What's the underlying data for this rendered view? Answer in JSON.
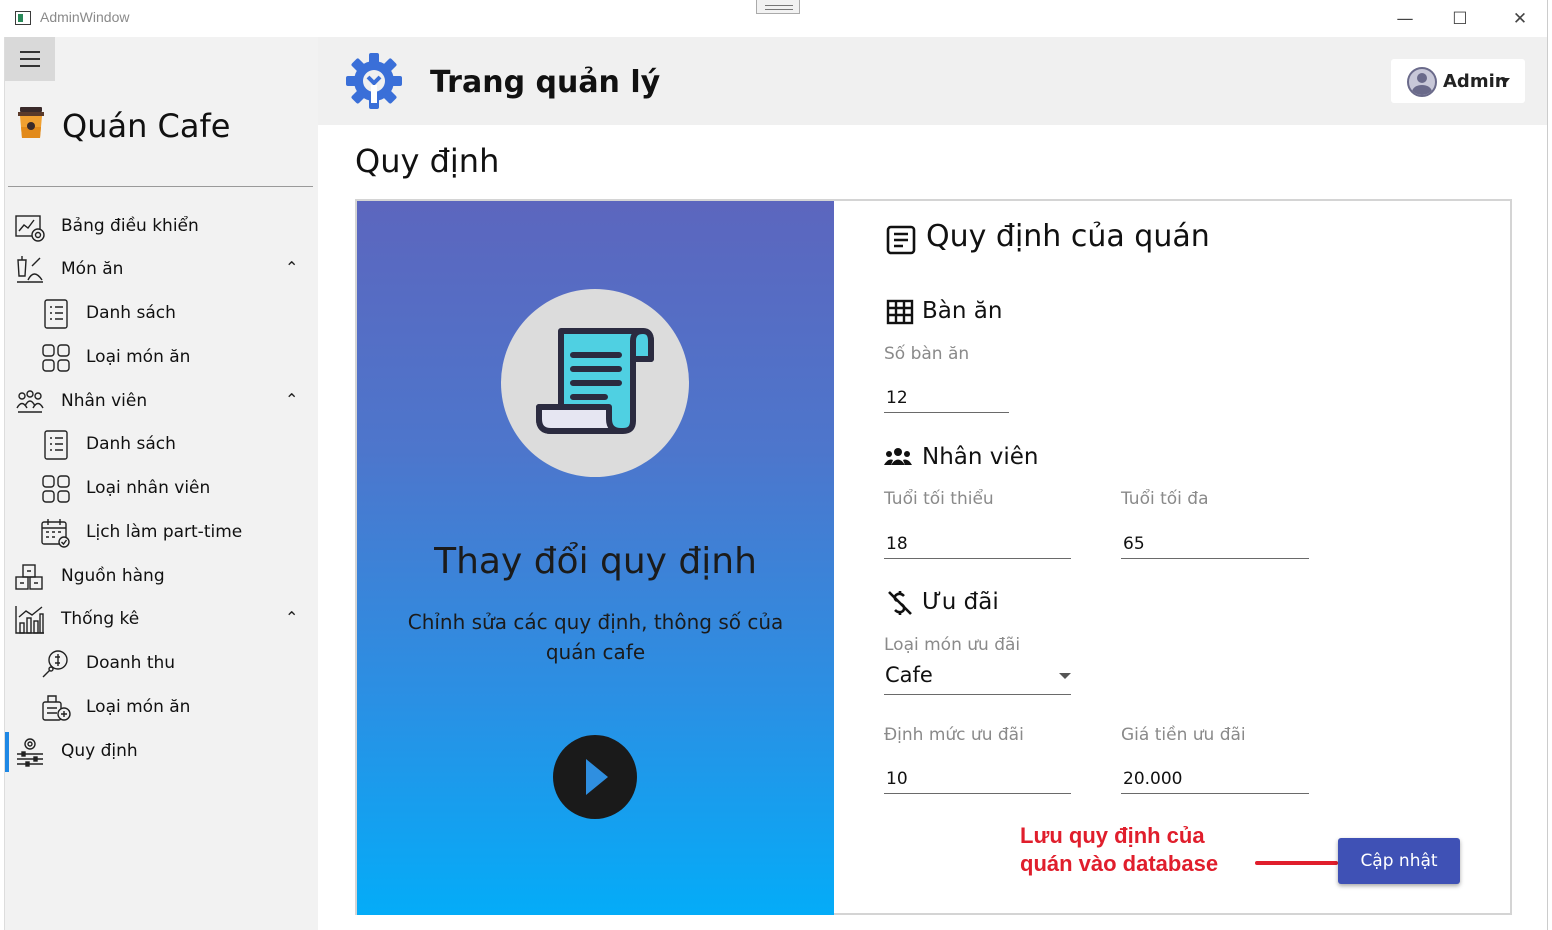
{
  "window": {
    "title": "AdminWindow",
    "minimize_glyph": "—",
    "maximize_glyph": "☐",
    "close_glyph": "✕"
  },
  "sidebar": {
    "brand": "Quán Cafe",
    "items": [
      {
        "label": "Bảng điều khiển",
        "icon": "dashboard-icon",
        "level": 0
      },
      {
        "label": "Món ăn",
        "icon": "food-icon",
        "level": 0,
        "expanded": true,
        "chevron": "⌃"
      },
      {
        "label": "Danh sách",
        "icon": "list-icon",
        "level": 1
      },
      {
        "label": "Loại món ăn",
        "icon": "category-icon",
        "level": 1
      },
      {
        "label": "Nhân viên",
        "icon": "staff-icon",
        "level": 0,
        "expanded": true,
        "chevron": "⌃"
      },
      {
        "label": "Danh sách",
        "icon": "list-icon",
        "level": 1
      },
      {
        "label": "Loại nhân viên",
        "icon": "category-icon",
        "level": 1
      },
      {
        "label": "Lịch làm part-time",
        "icon": "calendar-icon",
        "level": 1
      },
      {
        "label": "Nguồn hàng",
        "icon": "boxes-icon",
        "level": 0
      },
      {
        "label": "Thống kê",
        "icon": "chart-icon",
        "level": 0,
        "expanded": true,
        "chevron": "⌃"
      },
      {
        "label": "Doanh thu",
        "icon": "revenue-icon",
        "level": 1
      },
      {
        "label": "Loại món ăn",
        "icon": "food-stats-icon",
        "level": 1
      },
      {
        "label": "Quy định",
        "icon": "settings-sliders-icon",
        "level": 0,
        "active": true
      }
    ]
  },
  "header": {
    "title": "Trang quản lý",
    "user": "Admin"
  },
  "page": {
    "section_title": "Quy định"
  },
  "hero": {
    "heading": "Thay đổi quy định",
    "subtitle": "Chỉnh sửa các quy định, thông số của quán cafe"
  },
  "form": {
    "title": "Quy định của quán",
    "tables": {
      "heading": "Bàn ăn",
      "count_label": "Số bàn ăn",
      "count_value": "12"
    },
    "staff": {
      "heading": "Nhân viên",
      "min_age_label": "Tuổi tối thiểu",
      "min_age_value": "18",
      "max_age_label": "Tuổi tối đa",
      "max_age_value": "65"
    },
    "promo": {
      "heading": "Ưu đãi",
      "type_label": "Loại món ưu đãi",
      "type_value": "Cafe",
      "quota_label": "Định mức ưu đãi",
      "quota_value": "10",
      "price_label": "Giá tiền ưu đãi",
      "price_value": "20.000"
    },
    "submit_label": "Cập nhật"
  },
  "annotation": {
    "line1": "Lưu quy định của",
    "line2": "quán vào database",
    "color": "#e01e2c"
  },
  "colors": {
    "accent": "#3f51b5",
    "active_indicator": "#1e88e5"
  }
}
